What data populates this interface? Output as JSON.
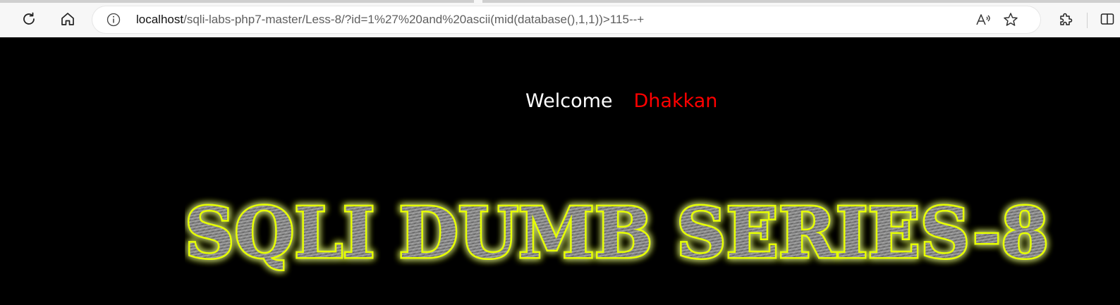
{
  "browser": {
    "refresh_icon": "refresh-icon",
    "home_icon": "home-icon",
    "address_bar": {
      "host": "localhost",
      "path": "/sqli-labs-php7-master/Less-8/?id=1%27%20and%20ascii(mid(database(),1,1))>115--+",
      "site_info_icon": "info-icon",
      "read_aloud_icon": "read-aloud-icon",
      "favorite_icon": "star-icon"
    },
    "extensions_icon": "puzzle-icon",
    "split_screen_icon": "split-screen-icon"
  },
  "page": {
    "welcome_label": "Welcome",
    "welcome_name": "Dhakkan",
    "banner_text": "SQLI DUMB SERIES-8",
    "colors": {
      "background": "#000000",
      "welcome": "#ffffff",
      "name": "#ff0000",
      "banner_glow": "#e6ff00",
      "banner_fill": "#8a8a8a"
    }
  }
}
